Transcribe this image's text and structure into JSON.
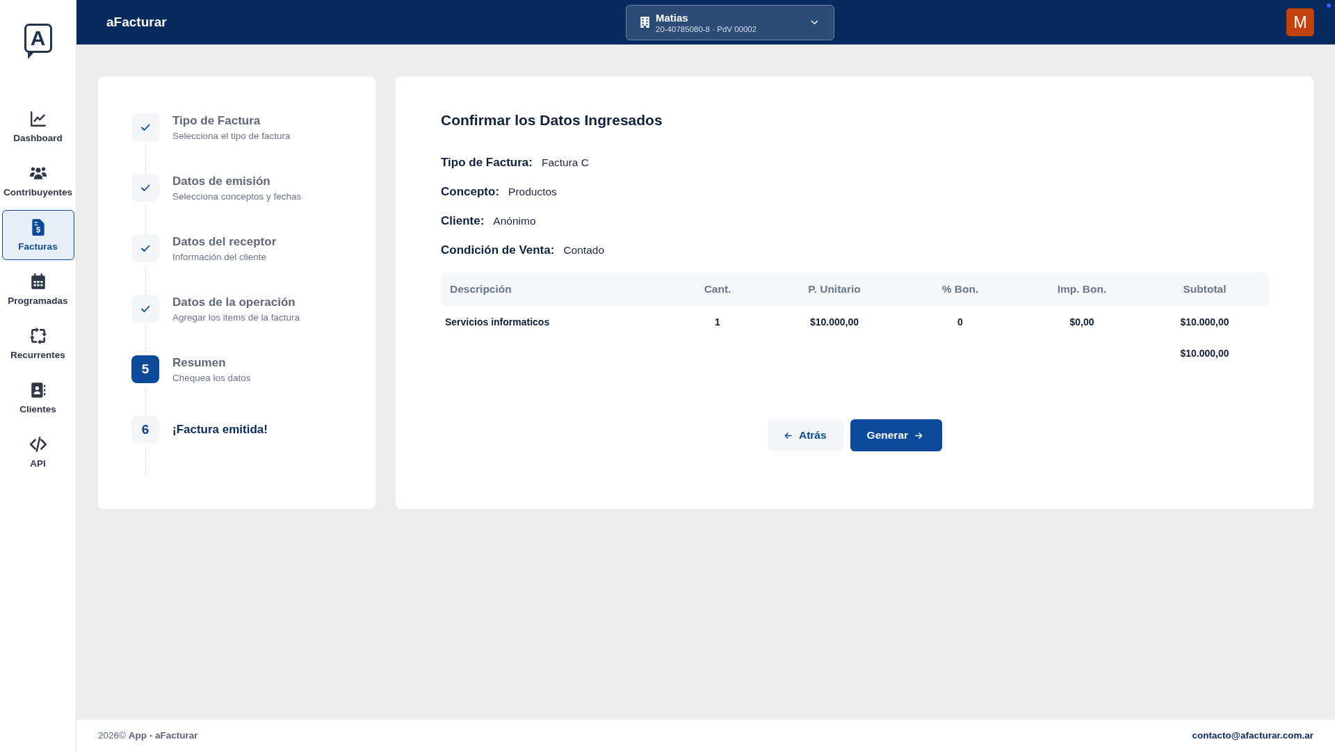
{
  "sidebar": {
    "logo": "A",
    "items": [
      {
        "label": "Dashboard",
        "selected": false
      },
      {
        "label": "Contribuyentes",
        "selected": false
      },
      {
        "label": "Facturas",
        "selected": true
      },
      {
        "label": "Programadas",
        "selected": false
      },
      {
        "label": "Recurrentes",
        "selected": false
      },
      {
        "label": "Clientes",
        "selected": false
      },
      {
        "label": "API",
        "selected": false
      }
    ]
  },
  "header": {
    "title": "aFacturar",
    "account": {
      "name": "Matias",
      "detail": "20-40785080-8 · PdV 00002"
    },
    "avatar": "M"
  },
  "steps": [
    {
      "title": "Tipo de Factura",
      "subtitle": "Selecciona el tipo de factura",
      "completed": true,
      "selected": false
    },
    {
      "title": "Datos de emisión",
      "subtitle": "Selecciona conceptos y fechas",
      "completed": true,
      "selected": false
    },
    {
      "title": "Datos del receptor",
      "subtitle": "Información del cliente",
      "completed": true,
      "selected": false
    },
    {
      "title": "Datos de la operación",
      "subtitle": "Agregar los items de la factura",
      "completed": true,
      "selected": false
    },
    {
      "number": "5",
      "title": "Resumen",
      "subtitle": "Chequea los datos",
      "completed": false,
      "selected": true
    },
    {
      "number": "6",
      "title": "¡Factura emitida!",
      "completed": false,
      "selected": false
    }
  ],
  "summary": {
    "title": "Confirmar los Datos Ingresados",
    "fields": [
      {
        "label": "Tipo de Factura:",
        "value": "Factura C"
      },
      {
        "label": "Concepto:",
        "value": "Productos"
      },
      {
        "label": "Cliente:",
        "value": "Anónimo"
      },
      {
        "label": "Condición de Venta:",
        "value": "Contado"
      }
    ],
    "table": {
      "columns": [
        "Descripción",
        "Cant.",
        "P. Unitario",
        "% Bon.",
        "Imp. Bon.",
        "Subtotal"
      ],
      "rows": [
        [
          "Servicios informaticos",
          "1",
          "$10.000,00",
          "0",
          "$0,00",
          "$10.000,00"
        ]
      ],
      "total": "$10.000,00"
    },
    "buttons": [
      {
        "label": "Atrás",
        "kind": "back"
      },
      {
        "label": "Generar",
        "kind": "next"
      }
    ]
  },
  "footer": {
    "copyright": "2026© **App - aFacturar**",
    "contact": "contacto@afacturar.com.ar"
  }
}
